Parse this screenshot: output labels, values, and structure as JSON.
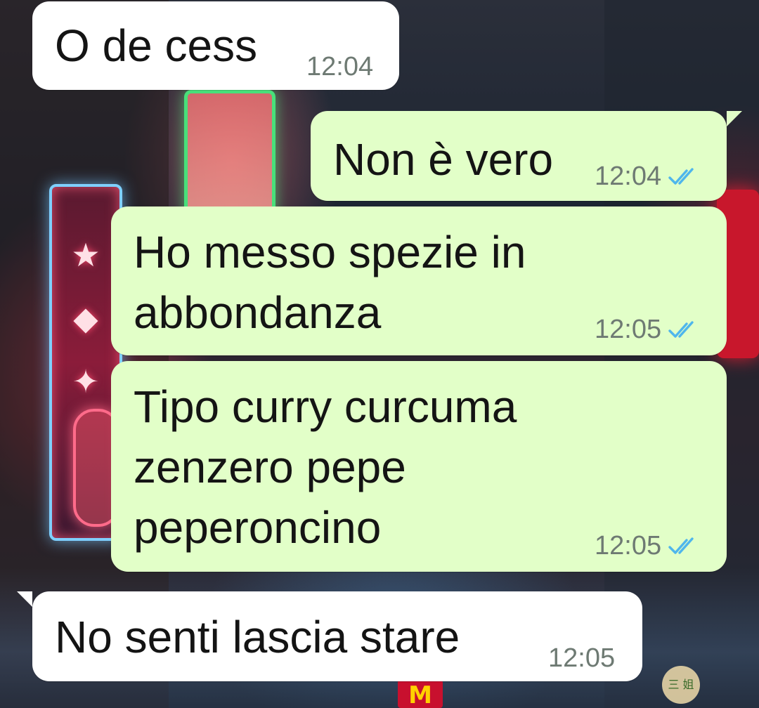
{
  "watermark": {
    "text": "三 姐"
  },
  "messages": [
    {
      "direction": "incoming",
      "text": "O de cess",
      "time": "12:04"
    },
    {
      "direction": "outgoing",
      "text": "Non è vero",
      "time": "12:04",
      "status": "read"
    },
    {
      "direction": "outgoing",
      "text": "Ho messo spezie in\nabbondanza",
      "time": "12:05",
      "status": "read"
    },
    {
      "direction": "outgoing",
      "text": "Tipo curry curcuma\nzenzero pepe\npeperoncino",
      "time": "12:05",
      "status": "read"
    },
    {
      "direction": "incoming",
      "text": "No senti lascia stare",
      "time": "12:05"
    }
  ],
  "colors": {
    "incoming_bubble": "#ffffff",
    "outgoing_bubble": "#e2ffc8",
    "read_ticks": "#4fb6ec",
    "timestamp": "#6e7a73"
  }
}
